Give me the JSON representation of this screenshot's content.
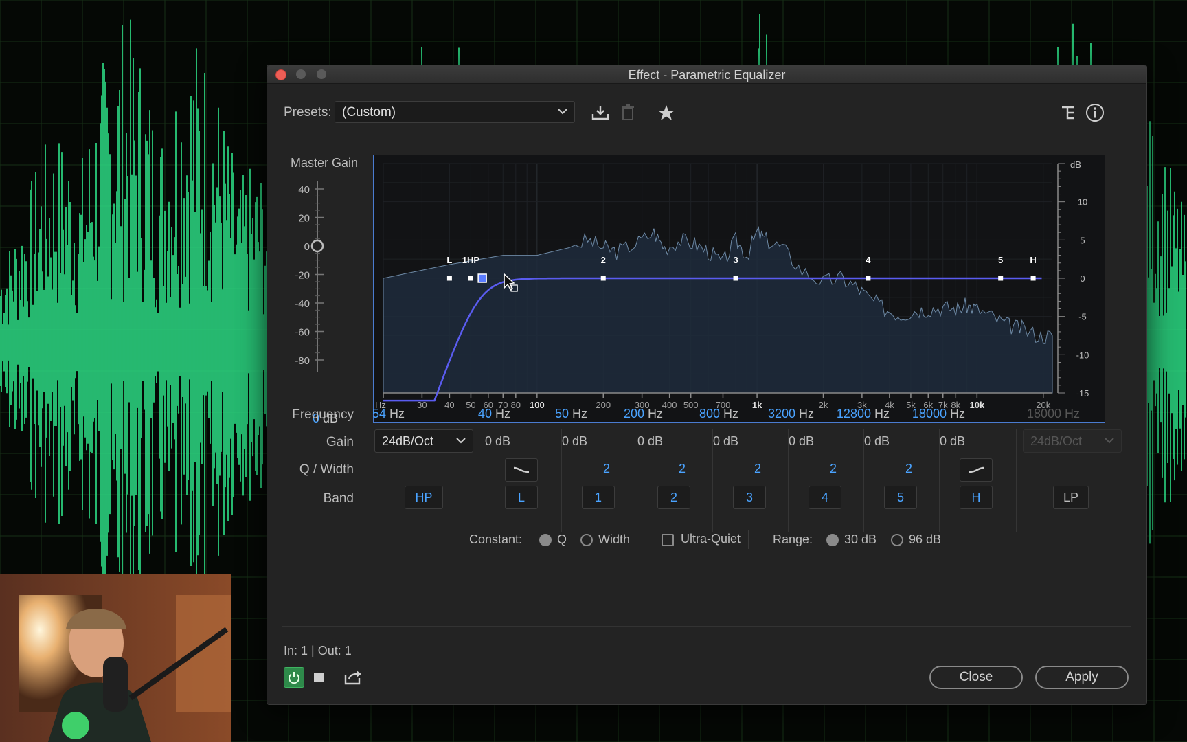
{
  "window": {
    "title": "Effect - Parametric Equalizer"
  },
  "presets": {
    "label": "Presets:",
    "value": "(Custom)"
  },
  "toolbar": {
    "icons": [
      "download-preset-icon",
      "trash-icon",
      "star-icon",
      "routing-icon",
      "info-icon"
    ]
  },
  "master_gain": {
    "label": "Master Gain",
    "scale_labels": [
      "40",
      "20",
      "0",
      "-20",
      "-40",
      "-60",
      "-80"
    ],
    "value": "0",
    "unit": "dB"
  },
  "graph": {
    "db_axis_title": "dB",
    "db_ticks": [
      "10",
      "5",
      "0",
      "-5",
      "-10",
      "-15"
    ],
    "freq_axis_title": "Hz",
    "freq_ticks": [
      "30",
      "40",
      "50",
      "60",
      "70",
      "80",
      "100",
      "200",
      "300",
      "400",
      "500",
      "700",
      "1k",
      "2k",
      "3k",
      "4k",
      "5k",
      "6k",
      "7k",
      "8k",
      "10k",
      "20k"
    ],
    "node_labels": [
      "L",
      "1HP",
      "2",
      "3",
      "4",
      "5",
      "H"
    ]
  },
  "rows": {
    "frequency": "Frequency",
    "gain": "Gain",
    "q_width": "Q / Width",
    "band": "Band"
  },
  "bands": [
    {
      "id": "hp",
      "freq": "54",
      "unit": "Hz",
      "slope": "24dB/Oct",
      "band": "HP"
    },
    {
      "id": "l",
      "freq": "40",
      "unit": "Hz",
      "gain": "0",
      "gain_unit": "dB",
      "q_shape": "low-shelf-icon",
      "band": "L"
    },
    {
      "id": "1",
      "freq": "50",
      "unit": "Hz",
      "gain": "0",
      "gain_unit": "dB",
      "q": "2",
      "band": "1"
    },
    {
      "id": "2",
      "freq": "200",
      "unit": "Hz",
      "gain": "0",
      "gain_unit": "dB",
      "q": "2",
      "band": "2"
    },
    {
      "id": "3",
      "freq": "800",
      "unit": "Hz",
      "gain": "0",
      "gain_unit": "dB",
      "q": "2",
      "band": "3"
    },
    {
      "id": "4",
      "freq": "3200",
      "unit": "Hz",
      "gain": "0",
      "gain_unit": "dB",
      "q": "2",
      "band": "4"
    },
    {
      "id": "5",
      "freq": "12800",
      "unit": "Hz",
      "gain": "0",
      "gain_unit": "dB",
      "q": "2",
      "band": "5"
    },
    {
      "id": "h",
      "freq": "18000",
      "unit": "Hz",
      "gain": "0",
      "gain_unit": "dB",
      "q_shape": "high-shelf-icon",
      "band": "H"
    },
    {
      "id": "lp",
      "freq": "18000 Hz",
      "slope": "24dB/Oct",
      "band": "LP",
      "disabled": true
    }
  ],
  "constant": {
    "label": "Constant:",
    "q": "Q",
    "width": "Width",
    "selected": "Q",
    "ultra_quiet": "Ultra-Quiet",
    "ultra_quiet_checked": false
  },
  "range": {
    "label": "Range:",
    "opt30": "30 dB",
    "opt96": "96 dB",
    "selected": "30 dB"
  },
  "footer": {
    "io": "In: 1 | Out: 1",
    "close": "Close",
    "apply": "Apply"
  },
  "colors": {
    "accent": "#4aa3ff",
    "curve": "#5a5cf0",
    "waveform": "#2ee58a",
    "power": "#2e8a4a",
    "close_dot": "#ed5e56"
  }
}
